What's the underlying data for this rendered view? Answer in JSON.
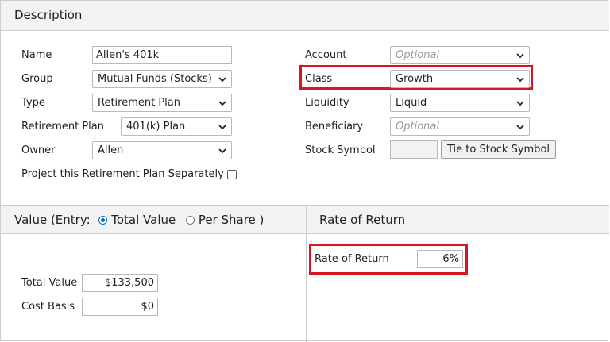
{
  "description": {
    "header": "Description",
    "name": {
      "label": "Name",
      "value": "Allen's 401k"
    },
    "group": {
      "label": "Group",
      "value": "Mutual Funds (Stocks)"
    },
    "type": {
      "label": "Type",
      "value": "Retirement Plan"
    },
    "retirement_plan": {
      "label": "Retirement Plan",
      "value": "401(k) Plan"
    },
    "owner": {
      "label": "Owner",
      "value": "Allen"
    },
    "project_separately": {
      "label": "Project this Retirement Plan Separately",
      "checked": false
    },
    "account": {
      "label": "Account",
      "placeholder": "Optional"
    },
    "class": {
      "label": "Class",
      "value": "Growth"
    },
    "liquidity": {
      "label": "Liquidity",
      "value": "Liquid"
    },
    "beneficiary": {
      "label": "Beneficiary",
      "placeholder": "Optional"
    },
    "stock_symbol": {
      "label": "Stock Symbol",
      "value": "",
      "button": "Tie to Stock Symbol"
    }
  },
  "value": {
    "header_prefix": "Value (Entry:",
    "option_total": "Total Value",
    "option_per_share": "Per Share )",
    "selected": "Total Value",
    "total_value": {
      "label": "Total Value",
      "value": "$133,500"
    },
    "cost_basis": {
      "label": "Cost Basis",
      "value": "$0"
    }
  },
  "rate": {
    "header": "Rate of Return",
    "label": "Rate of Return",
    "value": "6%"
  },
  "colors": {
    "highlight": "#d9161f",
    "radio_accent": "#0b64c8",
    "header_bg": "#f3f3f3"
  }
}
